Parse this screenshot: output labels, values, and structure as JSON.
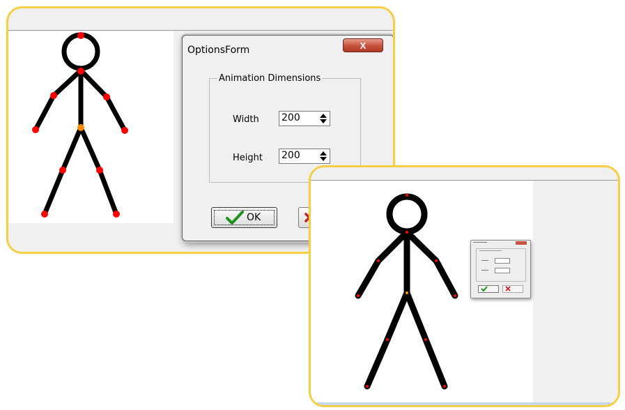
{
  "options_dialog": {
    "title": "OptionsForm",
    "close_glyph": "X",
    "group_label": "Animation Dimensions",
    "width_label": "Width",
    "width_value": "200",
    "height_label": "Height",
    "height_value": "200",
    "ok_label": "OK",
    "ok_icon": "checkmark-icon",
    "cancel_icon": "cancel-x-icon"
  },
  "colors": {
    "panel_border": "#f5cf45",
    "joint": "#ff0000",
    "hip_joint": "#ff8c00",
    "figure": "#000000"
  }
}
